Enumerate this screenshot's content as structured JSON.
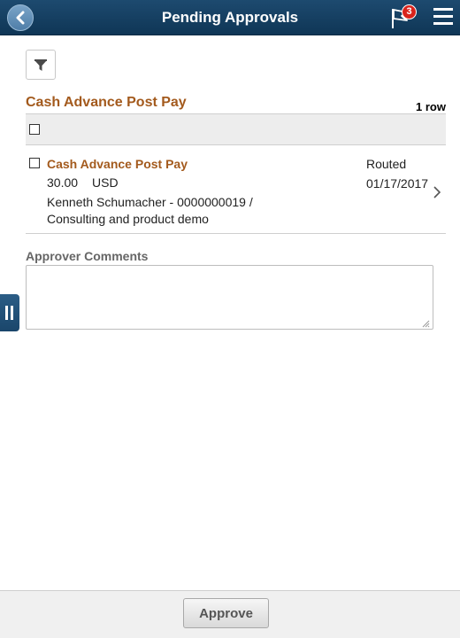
{
  "header": {
    "title": "Pending Approvals",
    "notification_count": "3",
    "back_icon": "chevron-left-icon",
    "flag_icon": "flag-icon",
    "menu_icon": "hamburger-menu-icon"
  },
  "toolbar": {
    "filter_icon": "filter-icon"
  },
  "section": {
    "title": "Cash Advance Post Pay",
    "row_count": "1 row"
  },
  "rows": [
    {
      "title": "Cash Advance Post Pay",
      "amount": "30.00",
      "currency": "USD",
      "description_line1": "Kenneth Schumacher - 0000000019 /",
      "description_line2": "Consulting and product demo",
      "status": "Routed",
      "date": "01/17/2017"
    }
  ],
  "comments": {
    "label": "Approver Comments",
    "value": ""
  },
  "footer": {
    "approve_label": "Approve"
  },
  "colors": {
    "header_bg": "#163f62",
    "accent_title": "#a35a1d",
    "badge": "#d9231c"
  }
}
